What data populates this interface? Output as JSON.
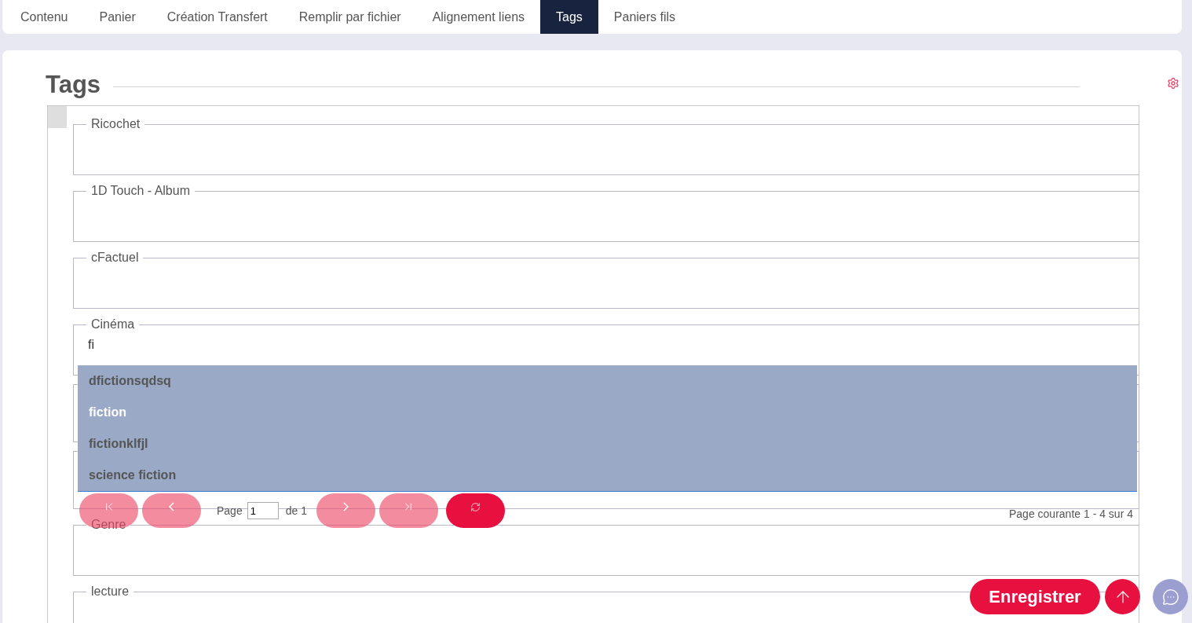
{
  "tabs": [
    {
      "label": "Contenu",
      "selected": false
    },
    {
      "label": "Panier",
      "selected": false
    },
    {
      "label": "Création Transfert",
      "selected": false
    },
    {
      "label": "Remplir par fichier",
      "selected": false
    },
    {
      "label": "Alignement liens",
      "selected": false
    },
    {
      "label": "Tags",
      "selected": true
    },
    {
      "label": "Paniers fils",
      "selected": false
    }
  ],
  "title": "Tags",
  "fieldsets": [
    {
      "legend": "Ricochet"
    },
    {
      "legend": "1D Touch - Album"
    },
    {
      "legend": "cFactuel"
    },
    {
      "legend": "Cinéma",
      "value": "fi"
    },
    {
      "kind": "covered"
    },
    {
      "kind": "covered"
    },
    {
      "legend": "Genre"
    },
    {
      "legend": "lecture"
    }
  ],
  "suggestions": [
    {
      "label": "dfictionsqdsq",
      "highlighted": false
    },
    {
      "label": "fiction",
      "highlighted": true
    },
    {
      "label": "fictionklfjl",
      "highlighted": false
    },
    {
      "label": "science fiction",
      "highlighted": false
    }
  ],
  "pager": {
    "page_label": "Page",
    "page": "1",
    "of_label": "de 1",
    "summary": "Page courante 1 - 4 sur 4"
  },
  "save_button": "Enregistrer"
}
